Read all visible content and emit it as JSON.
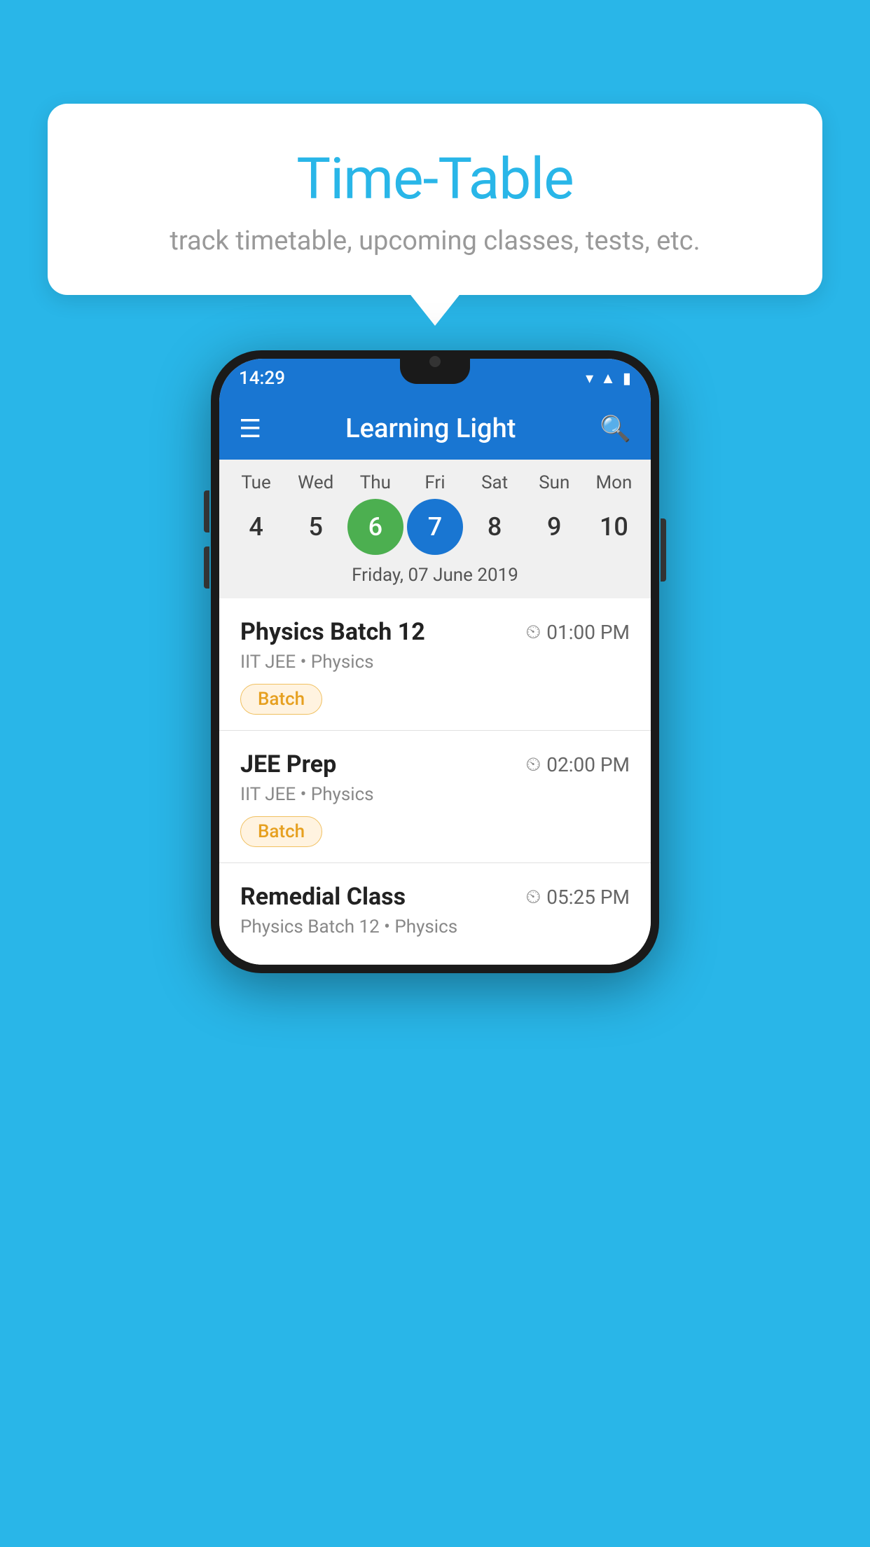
{
  "background_color": "#29b6e8",
  "tooltip": {
    "title": "Time-Table",
    "subtitle": "track timetable, upcoming classes, tests, etc."
  },
  "app": {
    "status_bar": {
      "time": "14:29"
    },
    "app_bar": {
      "title": "Learning Light",
      "menu_icon": "☰",
      "search_icon": "🔍"
    },
    "calendar": {
      "days": [
        "Tue",
        "Wed",
        "Thu",
        "Fri",
        "Sat",
        "Sun",
        "Mon"
      ],
      "dates": [
        "4",
        "5",
        "6",
        "7",
        "8",
        "9",
        "10"
      ],
      "today_index": 2,
      "selected_index": 3,
      "selected_label": "Friday, 07 June 2019"
    },
    "classes": [
      {
        "name": "Physics Batch 12",
        "time": "01:00 PM",
        "meta": "IIT JEE • Physics",
        "badge": "Batch"
      },
      {
        "name": "JEE Prep",
        "time": "02:00 PM",
        "meta": "IIT JEE • Physics",
        "badge": "Batch"
      },
      {
        "name": "Remedial Class",
        "time": "05:25 PM",
        "meta": "Physics Batch 12 • Physics",
        "badge": ""
      }
    ]
  }
}
